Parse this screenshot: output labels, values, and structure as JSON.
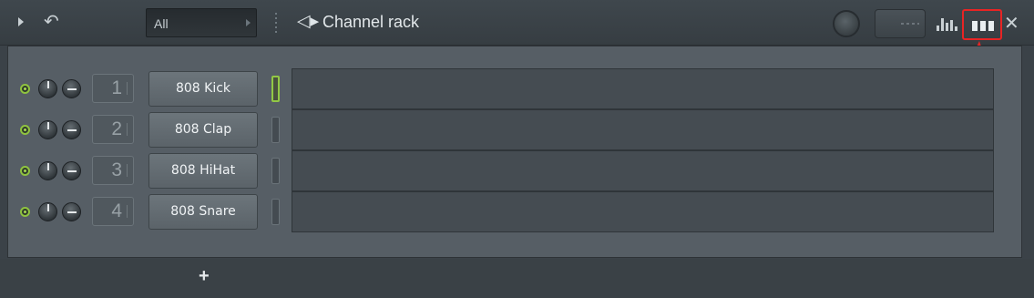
{
  "titlebar": {
    "filter_value": "All",
    "title": "Channel rack"
  },
  "channels": [
    {
      "number": "1",
      "name": "808 Kick",
      "selected": true
    },
    {
      "number": "2",
      "name": "808 Clap",
      "selected": false
    },
    {
      "number": "3",
      "name": "808 HiHat",
      "selected": false
    },
    {
      "number": "4",
      "name": "808 Snare",
      "selected": false
    }
  ],
  "footer": {
    "add_label": "+"
  },
  "colors": {
    "accent_green": "#8fc33f",
    "highlight_red": "#e82424",
    "panel_bg": "#565e65"
  },
  "icons": [
    "play-icon",
    "undo-icon",
    "speaker-icon",
    "graph-editor-icon",
    "step-sequencer-icon",
    "close-icon"
  ]
}
